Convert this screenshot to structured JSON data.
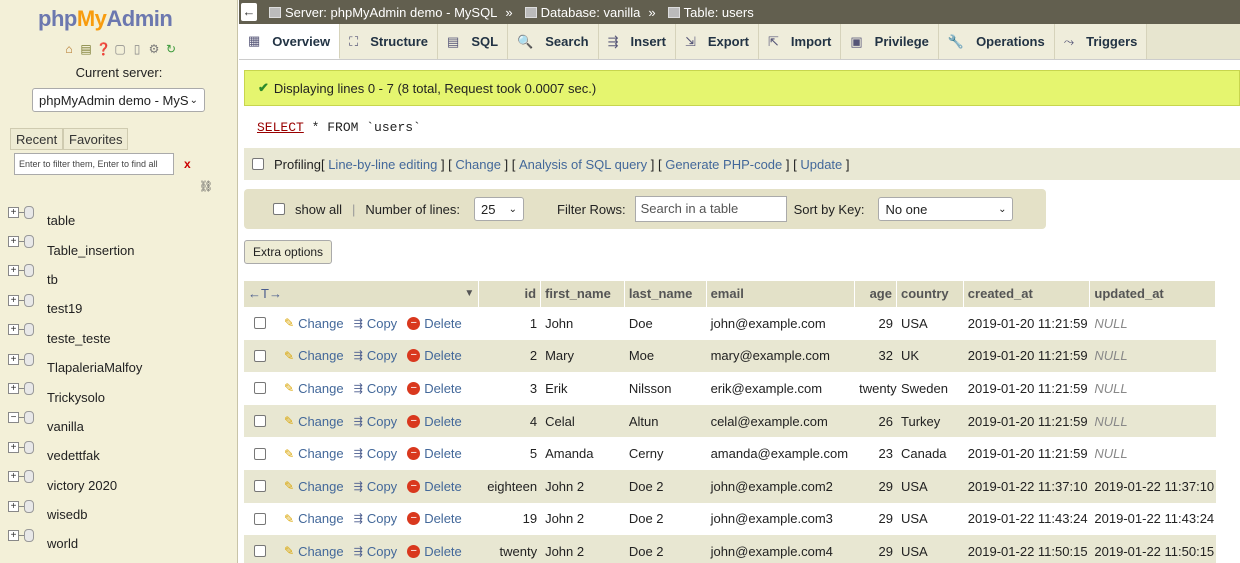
{
  "sidebar": {
    "logo_php": "php",
    "logo_my": "My",
    "logo_admin": "Admin",
    "current_server_label": "Current server:",
    "server_select": "phpMyAdmin demo - MyS",
    "tabs": [
      "Recent",
      "Favorites"
    ],
    "filter_placeholder": "Enter to filter them, Enter to find all",
    "filter_clear": "x",
    "databases": [
      "table",
      "Table_insertion",
      "tb",
      "test19",
      "teste_teste",
      "TlapaleriaMalfoy",
      "Trickysolo",
      "vanilla",
      "vedettfak",
      "victory 2020",
      "wisedb",
      "world"
    ],
    "expanded": "vanilla"
  },
  "breadcrumb": {
    "back": "←",
    "server": "Server: phpMyAdmin demo - MySQL",
    "database": "Database: vanilla",
    "table": "Table: users",
    "separator": "»"
  },
  "tabs": [
    {
      "label": "Overview",
      "icon": "overview-icon"
    },
    {
      "label": "Structure",
      "icon": "structure-icon"
    },
    {
      "label": "SQL",
      "icon": "sql-icon"
    },
    {
      "label": "Search",
      "icon": "search-icon"
    },
    {
      "label": "Insert",
      "icon": "insert-icon"
    },
    {
      "label": "Export",
      "icon": "export-icon"
    },
    {
      "label": "Import",
      "icon": "import-icon"
    },
    {
      "label": "Privilege",
      "icon": "privilege-icon"
    },
    {
      "label": "Operations",
      "icon": "operations-icon"
    },
    {
      "label": "Triggers",
      "icon": "triggers-icon"
    }
  ],
  "message": "Displaying lines 0 - 7 (8 total, Request took 0.0007 sec.)",
  "sql": {
    "kw1": "SELECT",
    "mid": " * FROM ",
    "table": "`users`"
  },
  "profiling": {
    "label": "Profiling",
    "links": [
      "Line-by-line editing",
      "Change",
      "Analysis of SQL query",
      "Generate PHP-code",
      "Update"
    ]
  },
  "navigation": {
    "show_all": "show all",
    "number_of_lines_label": "Number of lines:",
    "number_of_lines": "25",
    "filter_rows_label": "Filter Rows:",
    "filter_rows_placeholder": "Search in a table",
    "sort_by_label": "Sort by Key:",
    "sort_by_value": "No one"
  },
  "extra_options": "Extra options",
  "table": {
    "arrows": "←T→",
    "columns": [
      "id",
      "first_name",
      "last_name",
      "email",
      "age",
      "country",
      "created_at",
      "updated_at"
    ],
    "actions": {
      "change": "Change",
      "copy": "Copy",
      "delete": "Delete"
    },
    "rows": [
      [
        "1",
        "John",
        "Doe",
        "john@example.com",
        "29",
        "USA",
        "2019-01-20 11:21:59",
        "NULL"
      ],
      [
        "2",
        "Mary",
        "Moe",
        "mary@example.com",
        "32",
        "UK",
        "2019-01-20 11:21:59",
        "NULL"
      ],
      [
        "3",
        "Erik",
        "Nilsson",
        "erik@example.com",
        "twenty",
        "Sweden",
        "2019-01-20 11:21:59",
        "NULL"
      ],
      [
        "4",
        "Celal",
        "Altun",
        "celal@example.com",
        "26",
        "Turkey",
        "2019-01-20 11:21:59",
        "NULL"
      ],
      [
        "5",
        "Amanda",
        "Cerny",
        "amanda@example.com",
        "23",
        "Canada",
        "2019-01-20 11:21:59",
        "NULL"
      ],
      [
        "eighteen",
        "John 2",
        "Doe 2",
        "john@example.com2",
        "29",
        "USA",
        "2019-01-22 11:37:10",
        "2019-01-22 11:37:10"
      ],
      [
        "19",
        "John 2",
        "Doe 2",
        "john@example.com3",
        "29",
        "USA",
        "2019-01-22 11:43:24",
        "2019-01-22 11:43:24"
      ],
      [
        "twenty",
        "John 2",
        "Doe 2",
        "john@example.com4",
        "29",
        "USA",
        "2019-01-22 11:50:15",
        "2019-01-22 11:50:15"
      ]
    ]
  }
}
